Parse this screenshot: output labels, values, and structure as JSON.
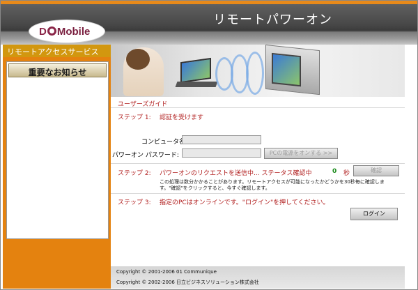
{
  "header": {
    "title": "リモートパワーオン",
    "logo_d": "D",
    "logo_mobile": "Mobile"
  },
  "sidebar": {
    "service_title": "リモートアクセスサービス",
    "notice_title": "重要なお知らせ"
  },
  "main": {
    "user_guide": "ユーザーズガイド",
    "step1": {
      "label": "ステップ 1:",
      "title": "認証を受けます"
    },
    "computer_name_label": "コンピュータ名:",
    "computer_name_value": "",
    "password_label": "パワーオン パスワード:",
    "password_value": "",
    "power_on_button": "PCの電源をオンする >>",
    "step2": {
      "label": "ステップ 2:",
      "title": "パワーオンのリクエストを送信中... ステータス確認中"
    },
    "counter_value": "0",
    "counter_unit": "秒",
    "confirm_button": "確認",
    "note": "この処理は数分かかることがあります。リモートアクセスが可能になったかどうかを30秒毎に確認します。\"確認\"をクリックすると、今すぐ確認します。",
    "step3": {
      "label": "ステップ 3:",
      "title": "指定のPCはオンラインです。\"ログイン\"を押してください。"
    },
    "login_button": "ログイン"
  },
  "footer": {
    "copyright1": "Copyright © 2001-2006 01 Communique",
    "copyright2": "Copyright © 2002-2006 日立ビジネスソリューション株式会社"
  },
  "colors": {
    "accent_orange": "#e4820f",
    "step_red": "#b01c1c",
    "counter_green": "#1a8a1a"
  }
}
